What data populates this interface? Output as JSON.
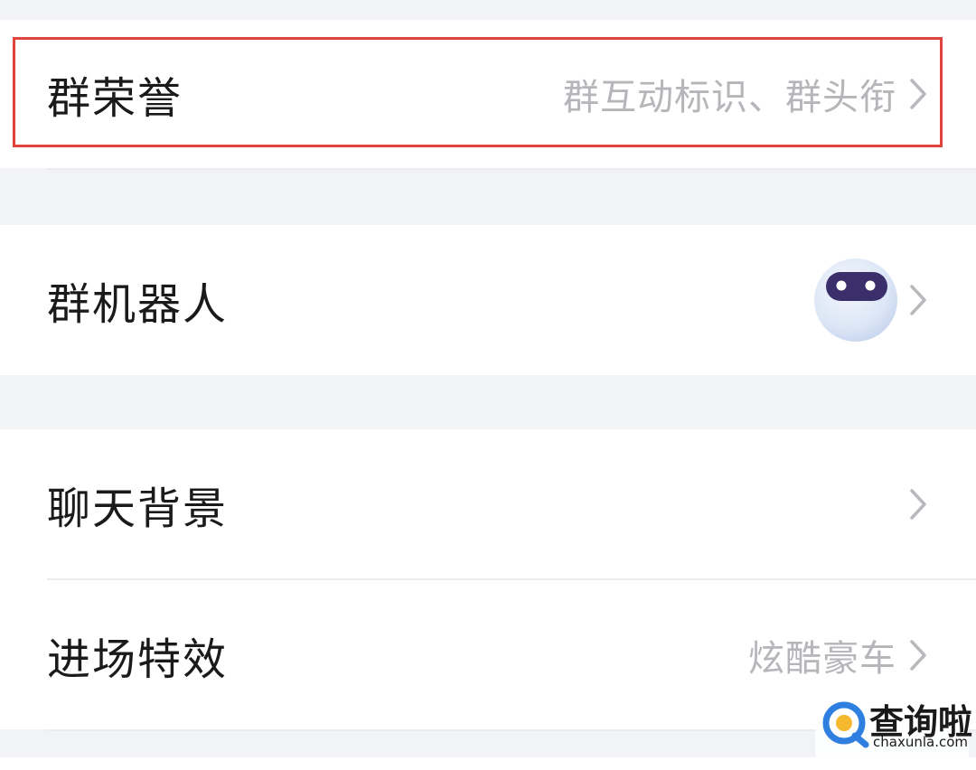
{
  "settings": {
    "group_honor": {
      "label": "群荣誉",
      "value": "群互动标识、群头衔"
    },
    "group_robot": {
      "label": "群机器人",
      "avatar_icon": "robot-avatar-icon"
    },
    "chat_background": {
      "label": "聊天背景"
    },
    "entry_effect": {
      "label": "进场特效",
      "value": "炫酷豪车"
    }
  },
  "watermark": {
    "name": "查询啦",
    "domain": "chaxunla.com"
  },
  "colors": {
    "highlight_border": "#E0453C",
    "section_background": "#F2F3F6",
    "secondary_text": "#B5B5BA",
    "chevron": "#B8B8BD",
    "robot_visor": "#3B2F6B",
    "watermark_accent": "#2F7FE0"
  }
}
